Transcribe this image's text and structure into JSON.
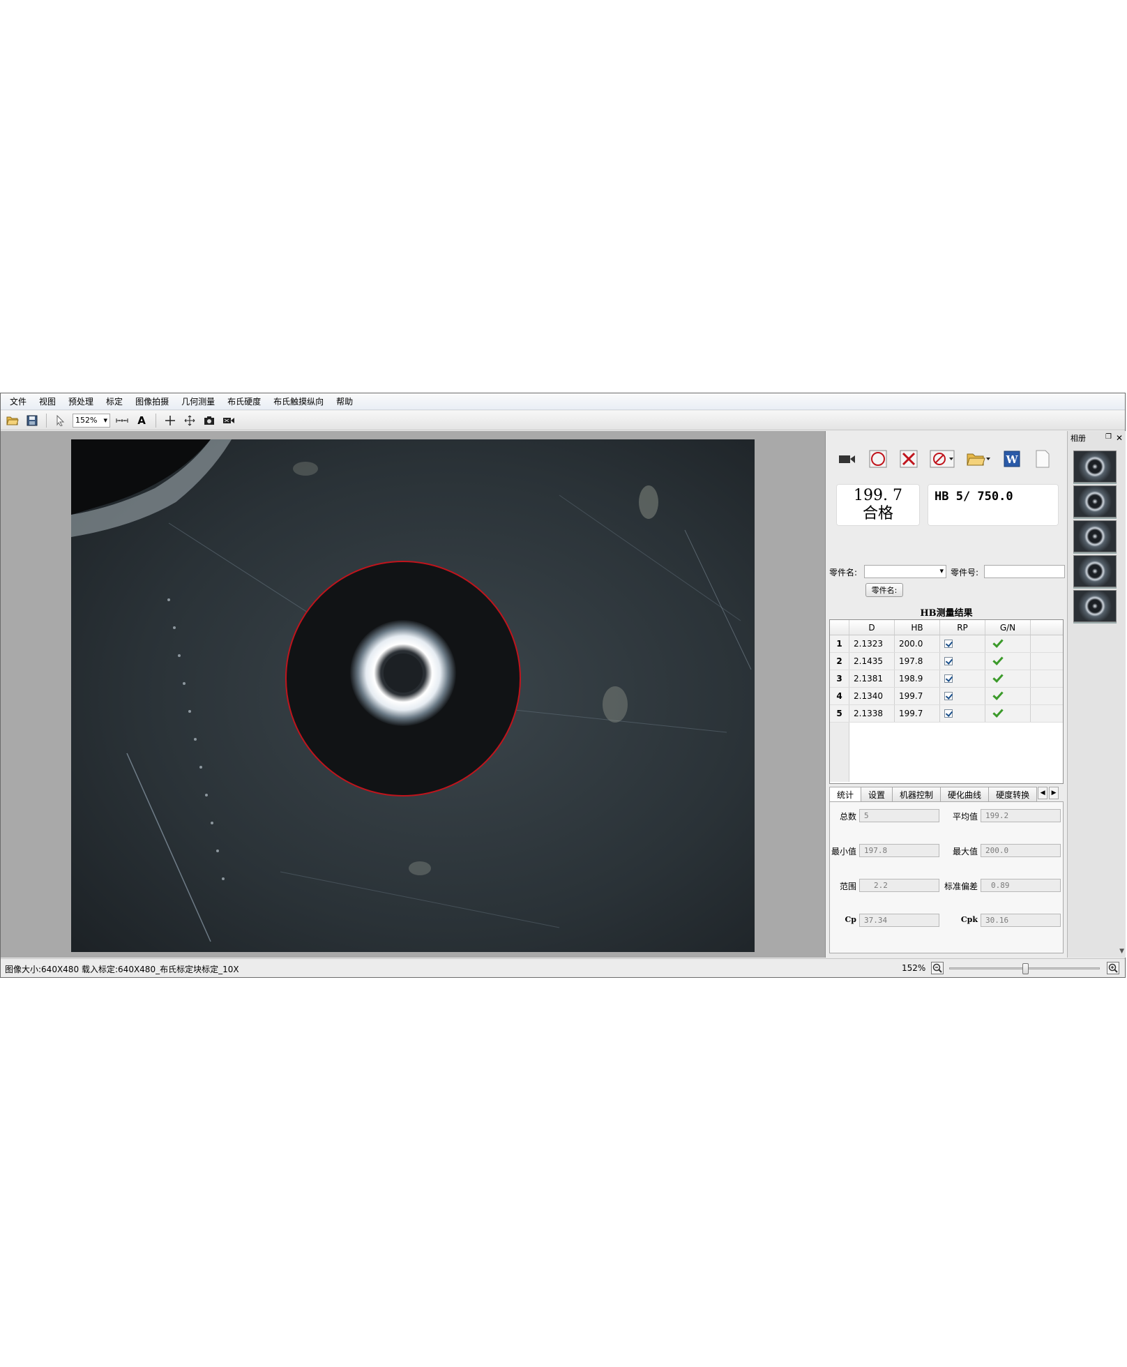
{
  "menu": [
    "文件",
    "视图",
    "预处理",
    "标定",
    "图像拍摄",
    "几何测量",
    "布氏硬度",
    "布氏触摸纵向",
    "帮助"
  ],
  "toolbar": {
    "zoom": "152%",
    "text_tool": "A"
  },
  "result": {
    "value": "199. 7",
    "status": "合格",
    "hb_setting": "HB 5/ 750.0"
  },
  "part": {
    "name_label": "零件名:",
    "number_label": "零件号:",
    "name_button": "零件名:"
  },
  "table": {
    "title": "HB测量结果",
    "headers": [
      "D",
      "HB",
      "RP",
      "G/N"
    ],
    "rows": [
      {
        "idx": "1",
        "d": "2.1323",
        "hb": "200.0"
      },
      {
        "idx": "2",
        "d": "2.1435",
        "hb": "197.8"
      },
      {
        "idx": "3",
        "d": "2.1381",
        "hb": "198.9"
      },
      {
        "idx": "4",
        "d": "2.1340",
        "hb": "199.7"
      },
      {
        "idx": "5",
        "d": "2.1338",
        "hb": "199.7"
      }
    ]
  },
  "tabs": [
    "统计",
    "设置",
    "机器控制",
    "硬化曲线",
    "硬度转换"
  ],
  "stats": {
    "total_label": "总数",
    "total": "5",
    "mean_label": "平均值",
    "mean": "199.2",
    "min_label": "最小值",
    "min": "197.8",
    "max_label": "最大值",
    "max": "200.0",
    "range_label": "范围",
    "range": "2.2",
    "std_label": "标准偏差",
    "std": "0.89",
    "cp_label": "Cp",
    "cp": "37.34",
    "cpk_label": "Cpk",
    "cpk": "30.16"
  },
  "album": {
    "title": "相册",
    "thumb_count": 5
  },
  "status": {
    "image_size": "图像大小:640X480",
    "calibration": "载入标定:640X480_布氏标定块标定_10X",
    "zoom": "152%",
    "zoom_level_fraction": 0.5
  },
  "colors": {
    "accent_red": "#c0141c",
    "check_green": "#3b9a2a",
    "word_blue": "#2a5aa8"
  }
}
